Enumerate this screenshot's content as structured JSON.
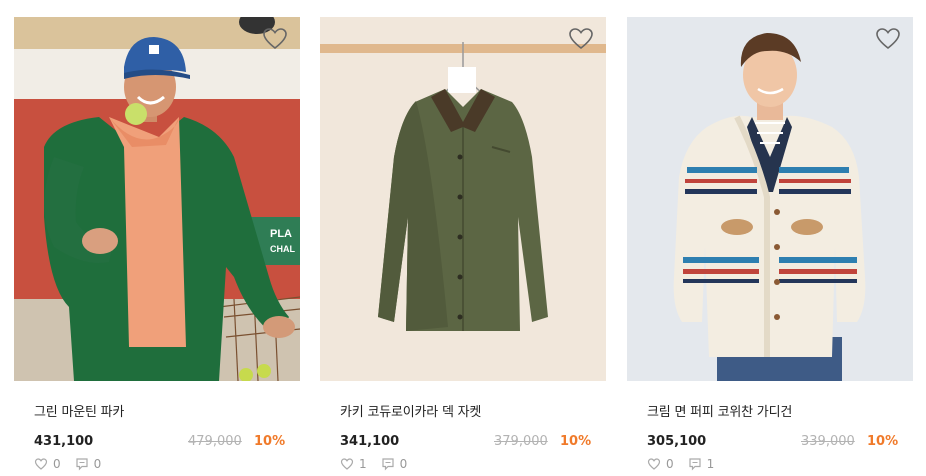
{
  "products": [
    {
      "name": "그린 마운틴 파카",
      "price": "431,100",
      "original_price": "479,000",
      "discount": "10%",
      "likes": "0",
      "reviews": "0"
    },
    {
      "name": "카키 코듀로이카라 덱 자켓",
      "price": "341,100",
      "original_price": "379,000",
      "discount": "10%",
      "likes": "1",
      "reviews": "0"
    },
    {
      "name": "크림 면 퍼피 코위찬 가디건",
      "price": "305,100",
      "original_price": "339,000",
      "discount": "10%",
      "likes": "0",
      "reviews": "1"
    }
  ],
  "photo_text": {
    "court_sign": "PLA\nCHAL"
  },
  "icons": {
    "wishlist": "heart-outline-icon",
    "likes": "heart-icon",
    "reviews": "comment-icon"
  },
  "colors": {
    "discount": "#f07a2a",
    "strike": "#b3b3b3",
    "meta": "#999999"
  }
}
